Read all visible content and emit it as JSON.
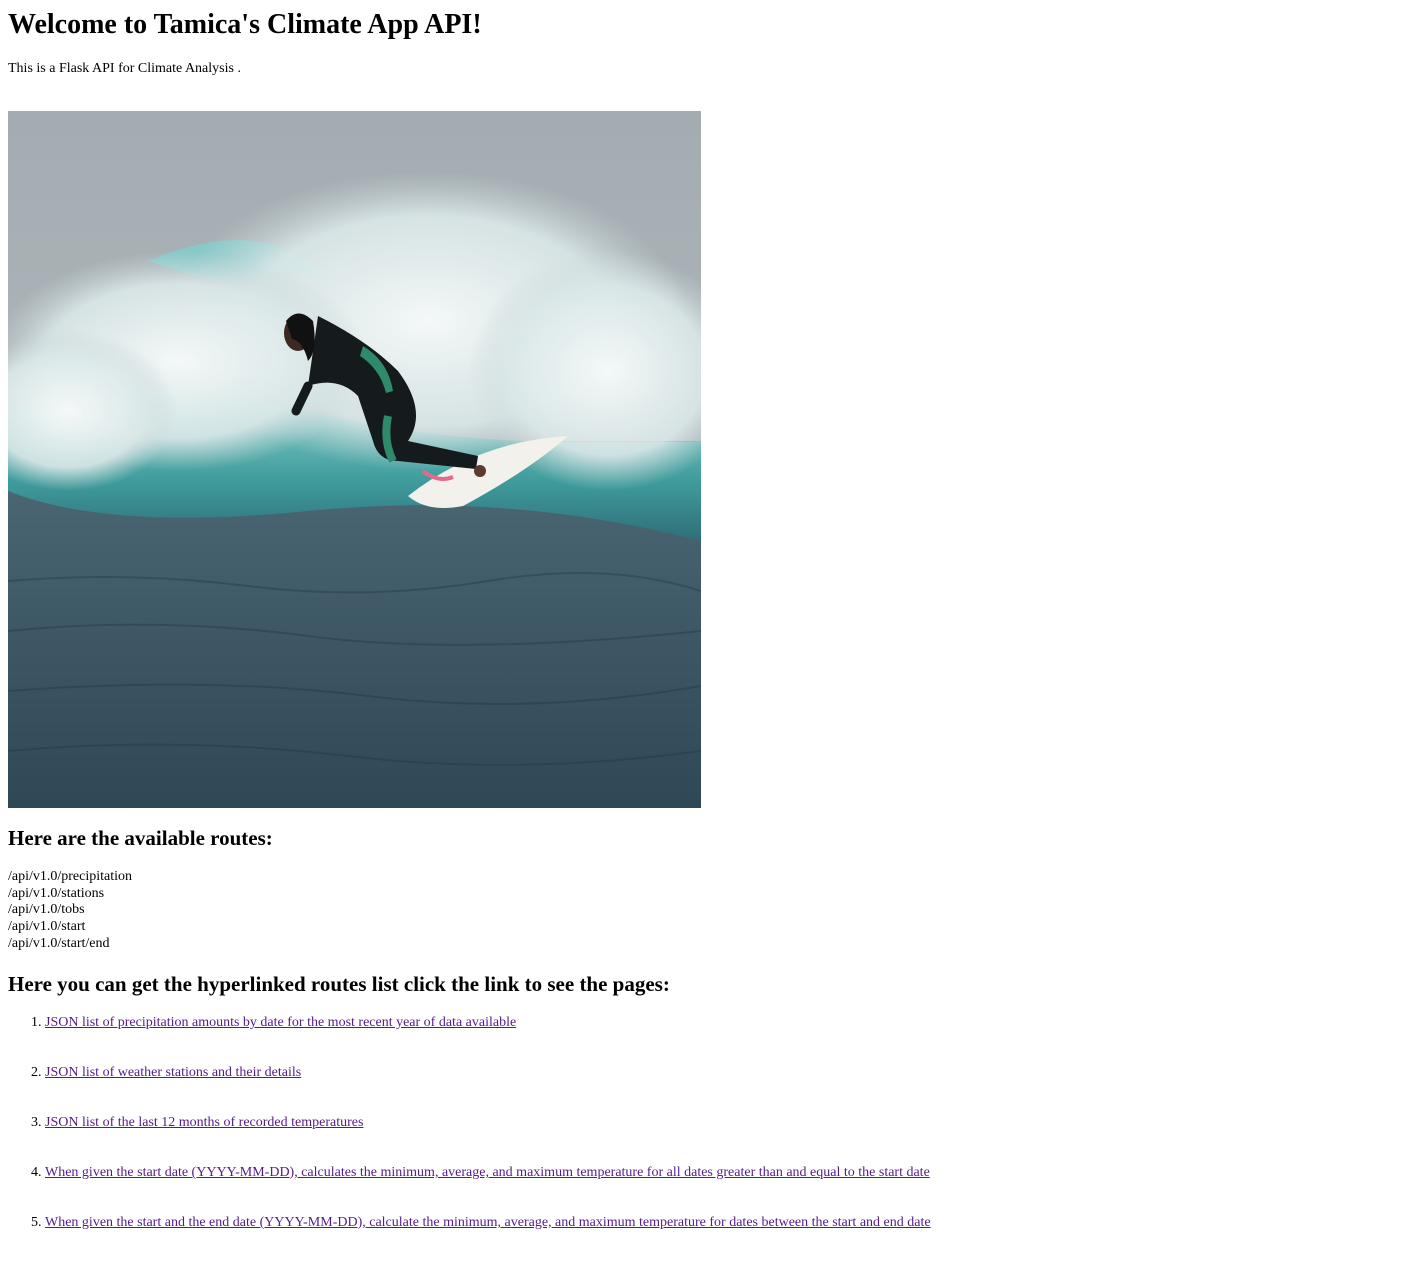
{
  "header": {
    "title": "Welcome to Tamica's Climate App API!",
    "subtitle": "This is a Flask API for Climate Analysis ."
  },
  "image": {
    "description_icon": "surfer-photo"
  },
  "routes": {
    "heading": "Here are the available routes:",
    "items": [
      "/api/v1.0/precipitation",
      "/api/v1.0/stations",
      "/api/v1.0/tobs",
      "/api/v1.0/start",
      "/api/v1.0/start/end"
    ]
  },
  "links": {
    "heading": "Here you can get the hyperlinked routes list click the link to see the pages:",
    "items": [
      "JSON list of precipitation amounts by date for the most recent year of data available",
      "JSON list of weather stations and their details",
      "JSON list of the last 12 months of recorded temperatures",
      "When given the start date (YYYY-MM-DD), calculates the minimum, average, and maximum temperature for all dates greater than and equal to the start date",
      "When given the start and the end date (YYYY-MM-DD), calculate the minimum, average, and maximum temperature for dates between the start and end date"
    ]
  },
  "colors": {
    "visited_link": "#551a8b",
    "text": "#000000",
    "background": "#ffffff"
  }
}
